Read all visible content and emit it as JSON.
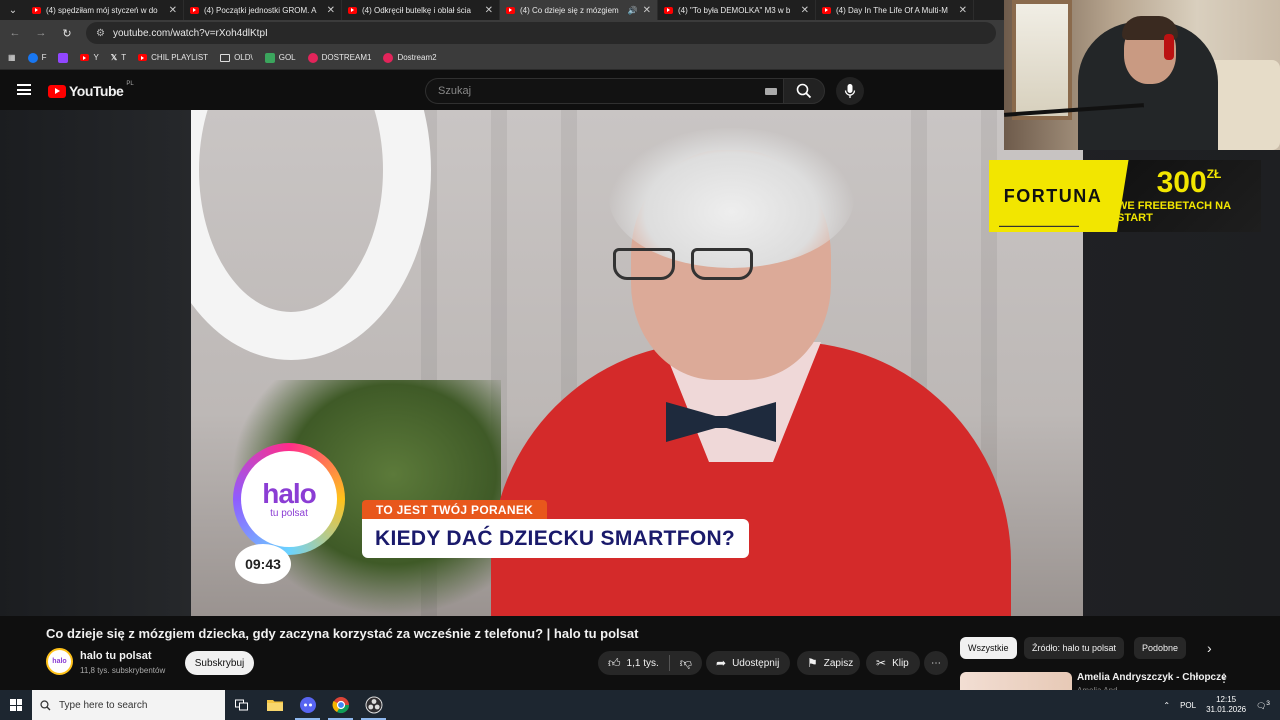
{
  "browser": {
    "tabs": [
      {
        "label": "(4) spędziłam mój styczeń w do",
        "active": false
      },
      {
        "label": "(4) Początki jednostki GROM. A",
        "active": false
      },
      {
        "label": "(4) Odkręcił butelkę i oblał ścia",
        "active": false
      },
      {
        "label": "(4) Co dzieje się z mózgiem",
        "active": true
      },
      {
        "label": "(4) \"To była DEMOLKA\" M3 w b",
        "active": false
      },
      {
        "label": "(4) Day In The Life Of A Multi-M",
        "active": false
      }
    ],
    "url": "youtube.com/watch?v=rXoh4dlKtpI",
    "bookmarks": [
      {
        "label": "F",
        "color": "#1877f2"
      },
      {
        "label": "",
        "color": "#9146ff"
      },
      {
        "label": "Y",
        "color": "#ff0000"
      },
      {
        "label": "T",
        "color": "#ffffff"
      },
      {
        "label": "CHIL PLAYLIST",
        "color": "#ff0000"
      },
      {
        "label": "OLD\\",
        "color": ""
      },
      {
        "label": "GOL",
        "color": "#3ba55d"
      },
      {
        "label": "DOSTREAM1",
        "color": "#e2245a"
      },
      {
        "label": "Dostream2",
        "color": "#e2245a"
      }
    ]
  },
  "youtube": {
    "logo_text": "YouTube",
    "region": "PL",
    "search_placeholder": "Szukaj"
  },
  "video": {
    "overlay_kicker": "TO JEST TWÓJ PORANEK",
    "overlay_headline": "KIEDY DAĆ DZIECKU SMARTFON?",
    "show_logo_word": "halo",
    "show_logo_sub": "tu polsat",
    "show_time": "09:43"
  },
  "ad": {
    "brand": "FORTUNA",
    "amount": "300",
    "currency": "ZŁ",
    "line": "WE FREEBETACH NA START"
  },
  "watch": {
    "title": "Co dzieje się z mózgiem dziecka, gdy zaczyna korzystać za wcześnie z telefonu? | halo tu polsat",
    "channel_name": "halo tu polsat",
    "subscribers": "11,8 tys. subskrybentów",
    "subscribe_label": "Subskrybuj",
    "likes": "1,1 tys.",
    "share_label": "Udostępnij",
    "save_label": "Zapisz",
    "clip_label": "Klip"
  },
  "sidebar": {
    "chips": [
      {
        "label": "Wszystkie",
        "active": true
      },
      {
        "label": "Źródło: halo tu polsat",
        "active": false
      },
      {
        "label": "Podobne",
        "active": false
      }
    ],
    "rec_title": "Amelia Andryszczyk - Chłopcze",
    "rec_channel": "Amelia And"
  },
  "taskbar": {
    "search_placeholder": "Type here to search",
    "language": "POL",
    "time": "12:15",
    "date": "31.01.2026",
    "notifications": "3"
  }
}
